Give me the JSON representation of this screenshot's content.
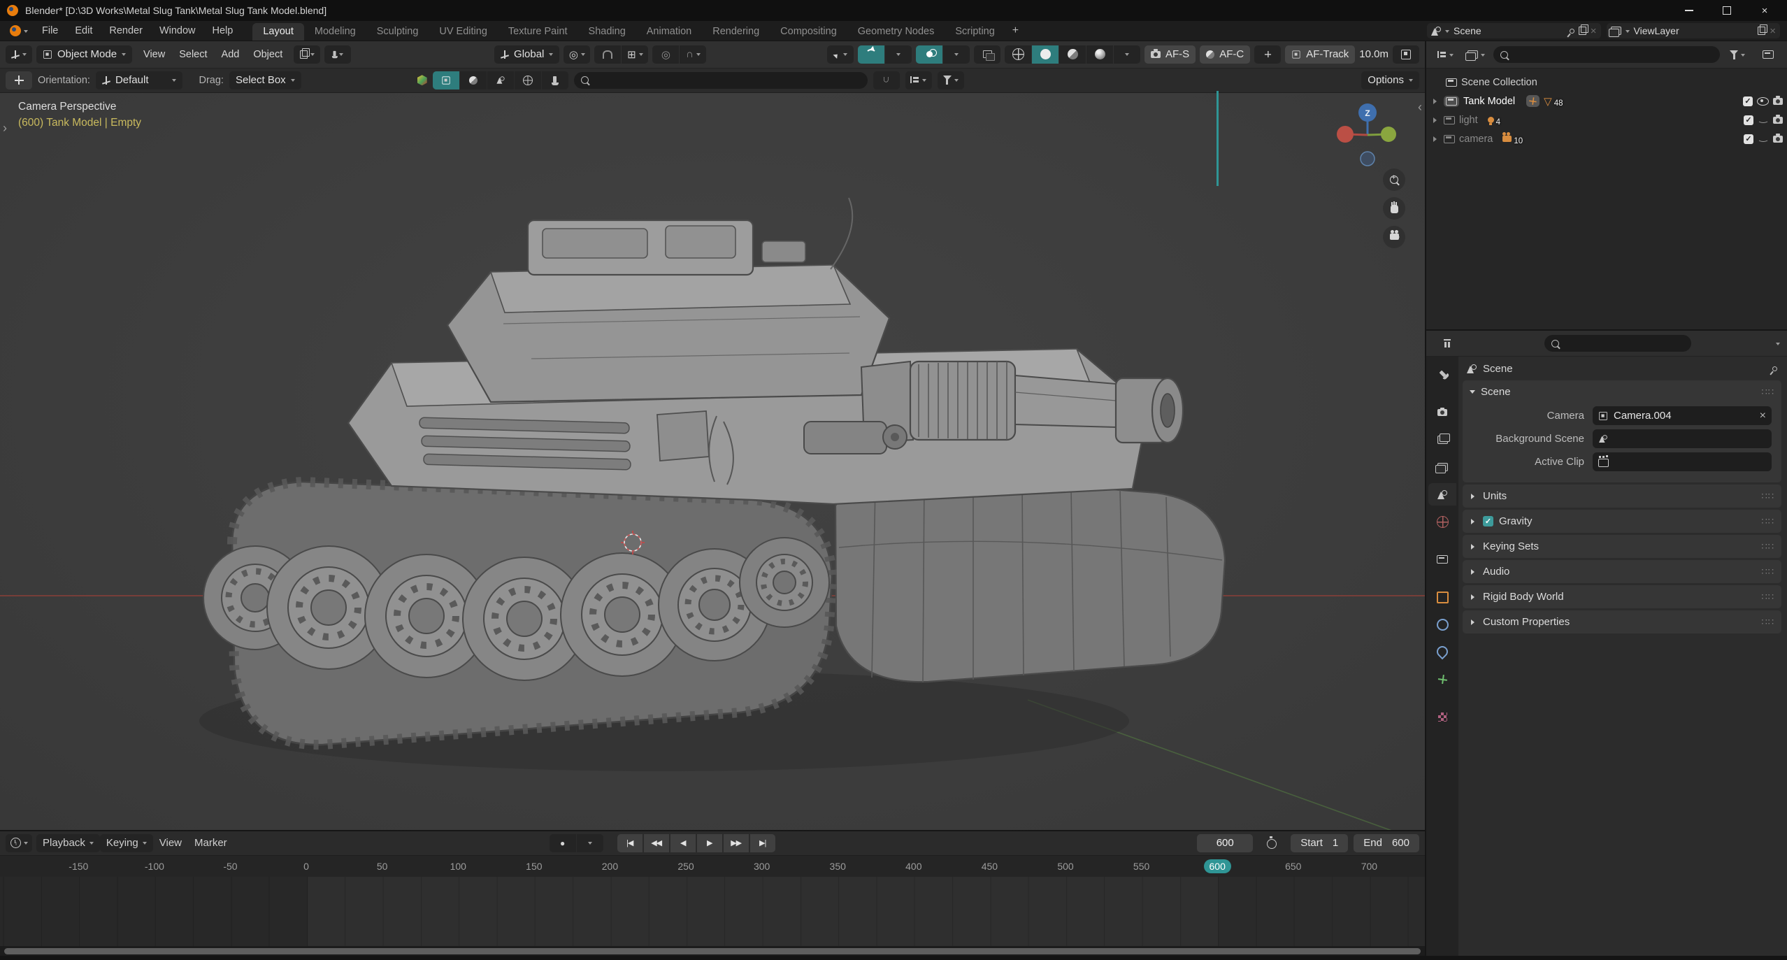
{
  "window": {
    "title": "Blender* [D:\\3D Works\\Metal Slug Tank\\Metal Slug Tank Model.blend]"
  },
  "topbar": {
    "menus": [
      "File",
      "Edit",
      "Render",
      "Window",
      "Help"
    ],
    "tabs": [
      {
        "label": "Layout",
        "active": true
      },
      {
        "label": "Modeling"
      },
      {
        "label": "Sculpting"
      },
      {
        "label": "UV Editing"
      },
      {
        "label": "Texture Paint"
      },
      {
        "label": "Shading"
      },
      {
        "label": "Animation"
      },
      {
        "label": "Rendering"
      },
      {
        "label": "Compositing"
      },
      {
        "label": "Geometry Nodes"
      },
      {
        "label": "Scripting"
      },
      {
        "label": "+",
        "add": true
      }
    ],
    "scene_name": "Scene",
    "viewlayer_name": "ViewLayer"
  },
  "viewport_header": {
    "mode": "Object Mode",
    "menus": [
      "View",
      "Select",
      "Add",
      "Object"
    ],
    "orientation": "Global",
    "af_s": "AF-S",
    "af_c": "AF-C",
    "af_track": "AF-Track",
    "af_distance": "10.0m"
  },
  "tool_settings": {
    "orientation_label": "Orientation:",
    "orientation_value": "Default",
    "drag_label": "Drag:",
    "drag_value": "Select Box",
    "options_label": "Options"
  },
  "viewport": {
    "view_label": "Camera Perspective",
    "object_label": "(600) Tank Model | Empty",
    "gizmo_z": "Z"
  },
  "outliner": {
    "root_label": "Scene Collection",
    "rows": [
      {
        "label": "Tank Model",
        "count": "48"
      },
      {
        "label": "light",
        "count": "4"
      },
      {
        "label": "camera",
        "count": "10"
      }
    ]
  },
  "properties": {
    "breadcrumb": "Scene",
    "tab_icons": [
      "tool",
      "render",
      "output",
      "view-layer",
      "scene",
      "world",
      "collection",
      "object",
      "physics",
      "constraints",
      "object-data",
      "texture"
    ],
    "scene_panel": {
      "title": "Scene",
      "camera_label": "Camera",
      "camera_value": "Camera.004",
      "background_scene_label": "Background Scene",
      "active_clip_label": "Active Clip"
    },
    "collapsed_panels": [
      {
        "title": "Units"
      },
      {
        "title": "Gravity",
        "checkbox": true
      },
      {
        "title": "Keying Sets"
      },
      {
        "title": "Audio"
      },
      {
        "title": "Rigid Body World"
      },
      {
        "title": "Custom Properties"
      }
    ]
  },
  "timeline": {
    "menus": [
      {
        "label": "Playback",
        "chevron": true
      },
      {
        "label": "Keying",
        "chevron": true
      },
      {
        "label": "View"
      },
      {
        "label": "Marker"
      }
    ],
    "current_frame": "600",
    "start_label": "Start",
    "start_value": "1",
    "end_label": "End",
    "end_value": "600",
    "ruler": [
      {
        "label": "-150"
      },
      {
        "label": "-100"
      },
      {
        "label": "-50"
      },
      {
        "label": "0"
      },
      {
        "label": "50"
      },
      {
        "label": "100"
      },
      {
        "label": "150"
      },
      {
        "label": "200"
      },
      {
        "label": "250"
      },
      {
        "label": "300"
      },
      {
        "label": "350"
      },
      {
        "label": "400"
      },
      {
        "label": "450"
      },
      {
        "label": "500"
      },
      {
        "label": "550"
      },
      {
        "label": "600",
        "current": true
      },
      {
        "label": "650"
      },
      {
        "label": "700"
      }
    ]
  },
  "icons": {
    "close": "×",
    "record": "●",
    "jump_start": "|◀",
    "prev_key": "◀◀",
    "play_back": "◀",
    "play": "▶",
    "next_key": "▶▶",
    "jump_end": "▶|",
    "mesh": "▽",
    "check": "✓",
    "falloff": "∩",
    "prop_edit": "◎",
    "snap_with": "⊞",
    "drag_dots": "∷∷",
    "collapse_left": "‹",
    "expand_right": "›"
  },
  "colors": {
    "accent_teal": "#2f9595",
    "axis_red": "#9a4038",
    "object_orange": "#d98d3f",
    "selection_yellow": "#c9ba5e"
  }
}
